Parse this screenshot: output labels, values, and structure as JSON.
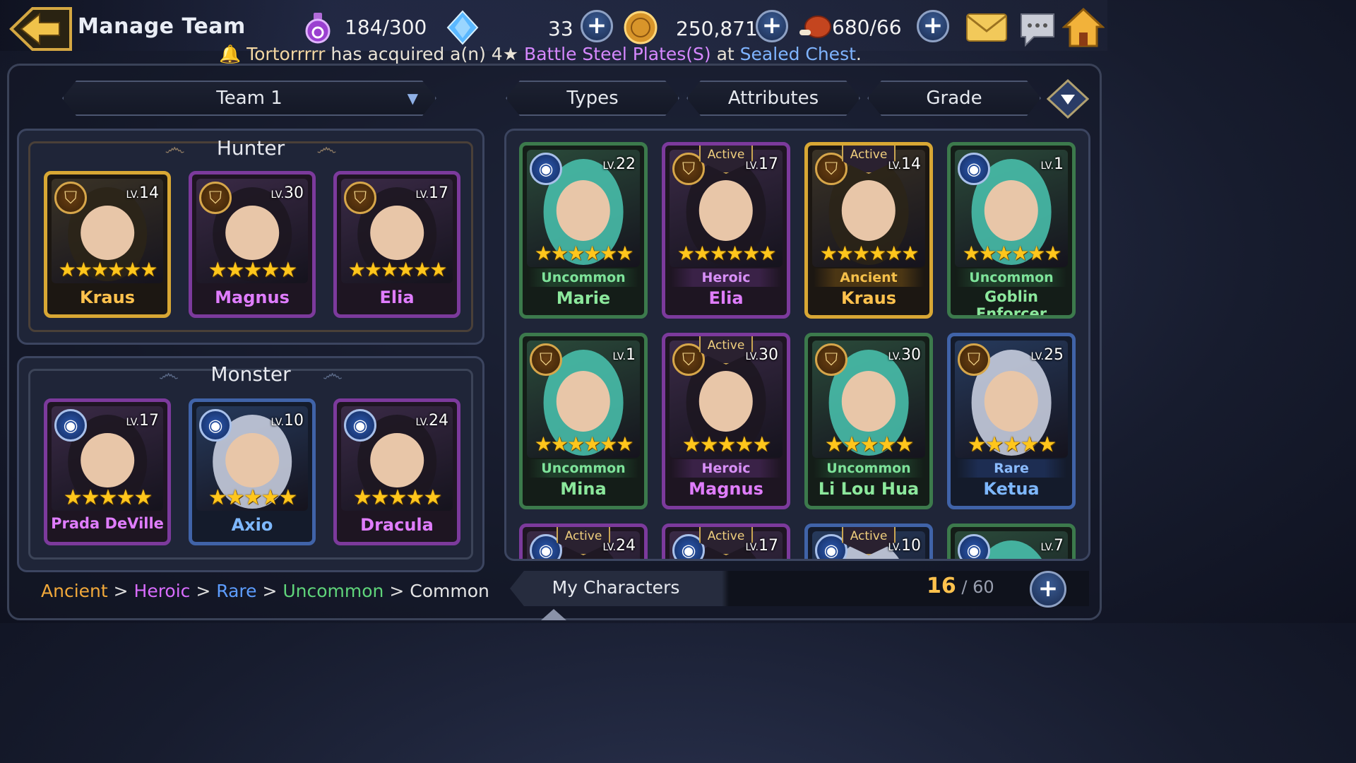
{
  "header": {
    "title": "Manage Team",
    "stamina": "184/300",
    "gems": "33",
    "gold": "250,871",
    "meat": "680/66"
  },
  "ticker": {
    "player": "Tortorrrrr",
    "text1": " has acquired a(n) 4",
    "star": "★",
    "item": " Battle Steel Plates(S)",
    "at": " at ",
    "location": "Sealed Chest",
    "end": "."
  },
  "filters": {
    "team": "Team 1",
    "types": "Types",
    "attributes": "Attributes",
    "grade": "Grade"
  },
  "hunter_section": {
    "title": "Hunter",
    "cards": [
      {
        "name": "Kraus",
        "level": "14",
        "rarity": "ancient",
        "badge": "shield",
        "stars": 6
      },
      {
        "name": "Magnus",
        "level": "30",
        "rarity": "heroic",
        "badge": "shield",
        "stars": 5
      },
      {
        "name": "Elia",
        "level": "17",
        "rarity": "heroic",
        "badge": "shield",
        "stars": 6
      }
    ]
  },
  "monster_section": {
    "title": "Monster",
    "cards": [
      {
        "name": "Prada DeVille",
        "level": "17",
        "rarity": "heroic",
        "badge": "orb",
        "stars": 5
      },
      {
        "name": "Axio",
        "level": "10",
        "rarity": "rare",
        "badge": "orb",
        "stars": 5
      },
      {
        "name": "Dracula",
        "level": "24",
        "rarity": "heroic",
        "badge": "orb",
        "stars": 5
      }
    ]
  },
  "roster": [
    {
      "name": "Marie",
      "level": "22",
      "grade": "Uncommon",
      "rarity": "uncommon",
      "badge": "orb",
      "stars": 6,
      "active": false
    },
    {
      "name": "Elia",
      "level": "17",
      "grade": "Heroic",
      "rarity": "heroic",
      "badge": "shield",
      "stars": 6,
      "active": true
    },
    {
      "name": "Kraus",
      "level": "14",
      "grade": "Ancient",
      "rarity": "ancient",
      "badge": "shield",
      "stars": 6,
      "active": true
    },
    {
      "name": "Goblin Enforcer",
      "level": "1",
      "grade": "Uncommon",
      "rarity": "uncommon",
      "badge": "orb",
      "stars": 6,
      "active": false
    },
    {
      "name": "Mina",
      "level": "1",
      "grade": "Uncommon",
      "rarity": "uncommon",
      "badge": "shield",
      "stars": 6,
      "active": false
    },
    {
      "name": "Magnus",
      "level": "30",
      "grade": "Heroic",
      "rarity": "heroic",
      "badge": "shield",
      "stars": 5,
      "active": true
    },
    {
      "name": "Li Lou Hua",
      "level": "30",
      "grade": "Uncommon",
      "rarity": "uncommon",
      "badge": "shield",
      "stars": 5,
      "active": false
    },
    {
      "name": "Ketua",
      "level": "25",
      "grade": "Rare",
      "rarity": "rare",
      "badge": "shield",
      "stars": 5,
      "active": false
    }
  ],
  "roster_partial": [
    {
      "level": "24",
      "rarity": "heroic",
      "active": true
    },
    {
      "level": "17",
      "rarity": "heroic",
      "active": true
    },
    {
      "level": "10",
      "rarity": "rare",
      "active": true
    },
    {
      "level": "7",
      "rarity": "uncommon",
      "active": false
    }
  ],
  "active_label": "Active",
  "level_prefix": "LV.",
  "legend": {
    "ancient": "Ancient",
    "heroic": "Heroic",
    "rare": "Rare",
    "uncommon": "Uncommon",
    "common": "Common",
    "sep": " > "
  },
  "footer": {
    "my_characters": "My Characters",
    "count": "16",
    "max": "60"
  },
  "colors": {
    "ancient": "#ffc24d",
    "heroic": "#e07dff",
    "rare": "#7eb8ff",
    "uncommon": "#8ce89c",
    "common": "#e6e6e6"
  },
  "icons": [
    "back-arrow-icon",
    "stamina-potion-icon",
    "gem-icon",
    "gold-coin-icon",
    "meat-icon",
    "mail-icon",
    "chat-icon",
    "home-icon",
    "dropdown-arrow-icon",
    "shield-icon",
    "orb-icon",
    "star-icon",
    "bell-icon",
    "plus-icon"
  ]
}
